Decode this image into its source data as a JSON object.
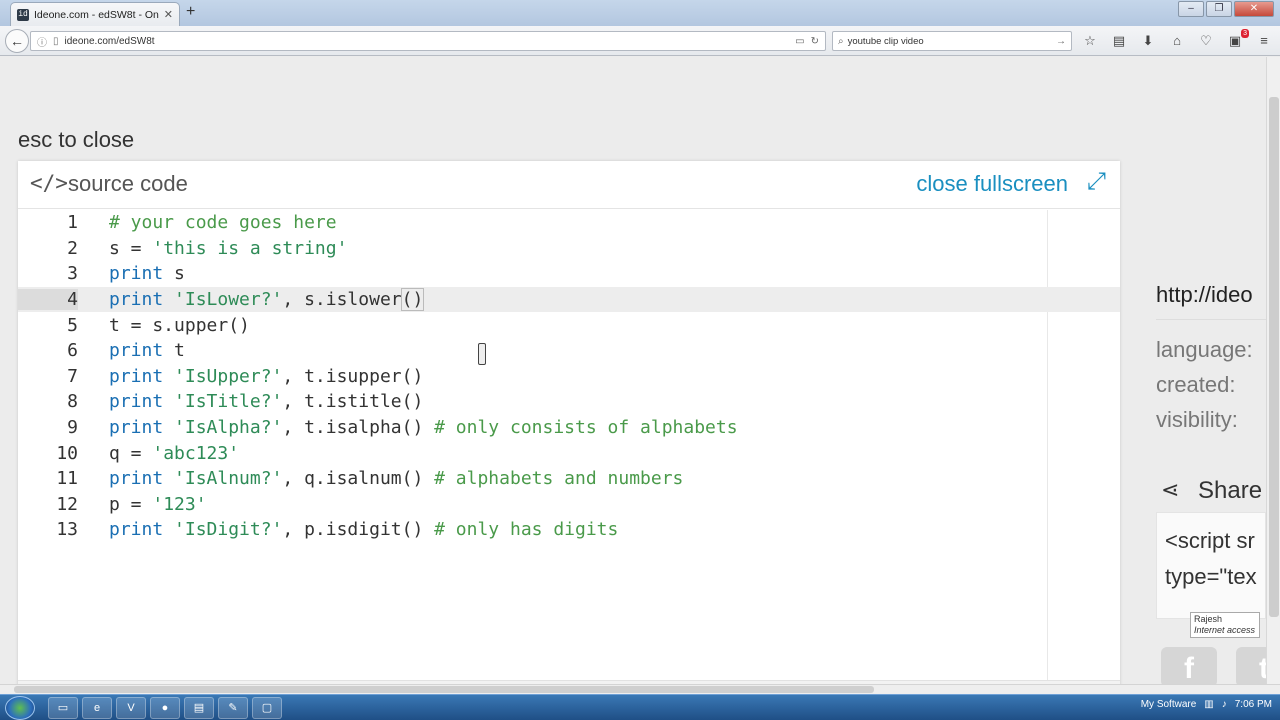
{
  "browser": {
    "tab_title": "Ideone.com - edSW8t - On...",
    "url": "ideone.com/edSW8t",
    "search_query": "youtube clip video",
    "notification_count": "3"
  },
  "page": {
    "esc_label": "esc to close",
    "panel_title": "source code",
    "fullscreen_link": "close fullscreen"
  },
  "editor": {
    "active_line": 4,
    "lines": [
      {
        "num": "1",
        "code": "# your code goes here"
      },
      {
        "num": "2",
        "code": "s = 'this is a string'"
      },
      {
        "num": "3",
        "code": "print s"
      },
      {
        "num": "4",
        "code": "print 'IsLower?', s.islower()"
      },
      {
        "num": "5",
        "code": "t = s.upper()"
      },
      {
        "num": "6",
        "code": "print t"
      },
      {
        "num": "7",
        "code": "print 'IsUpper?', t.isupper()"
      },
      {
        "num": "8",
        "code": "print 'IsTitle?', t.istitle()"
      },
      {
        "num": "9",
        "code": "print 'IsAlpha?', t.isalpha() # only consists of alphabets"
      },
      {
        "num": "10",
        "code": "q = 'abc123'"
      },
      {
        "num": "11",
        "code": "print 'IsAlnum?', q.isalnum() # alphabets and numbers"
      },
      {
        "num": "12",
        "code": "p = '123'"
      },
      {
        "num": "13",
        "code": "print 'IsDigit?', p.isdigit() # only has digits"
      }
    ]
  },
  "sidebar": {
    "url": "http://ideo",
    "language_label": "language:",
    "created_label": "created:",
    "visibility_label": "visibility:",
    "share_label": "Share",
    "embed_line1": "<script sr",
    "embed_line2": "type=\"tex"
  },
  "tooltip": {
    "name": "Rajesh",
    "status": "Internet access"
  },
  "taskbar": {
    "tray_label": "My Software",
    "clock": "7:06 PM"
  }
}
